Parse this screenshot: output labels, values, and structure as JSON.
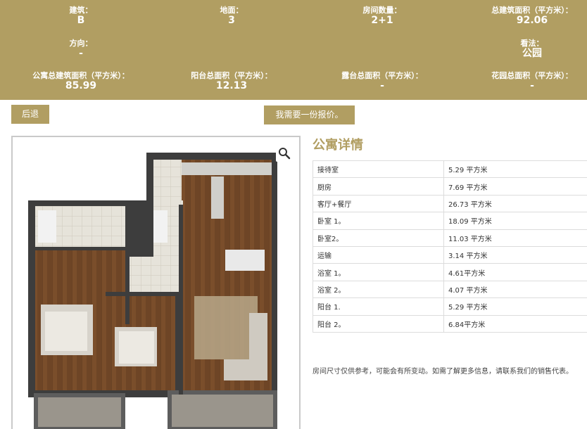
{
  "header": {
    "stats": [
      {
        "label": "建筑：",
        "value": "B"
      },
      {
        "label": "地面：",
        "value": "3"
      },
      {
        "label": "房间数量：",
        "value": "2+1"
      },
      {
        "label": "总建筑面积（平方米）：",
        "value": "92.06"
      },
      {
        "label": "方向：",
        "value": "-"
      },
      {
        "label": "看法：",
        "value": "公园"
      },
      {
        "label": "公寓总建筑面积（平方米）：",
        "value": "85.99"
      },
      {
        "label": "阳台总面积（平方米）：",
        "value": "12.13"
      },
      {
        "label": "露台总面积（平方米）：",
        "value": "-"
      },
      {
        "label": "花园总面积（平方米）：",
        "value": "-"
      }
    ]
  },
  "buttons": {
    "back": "后退",
    "quote": "我需要一份报价。"
  },
  "details": {
    "title": "公寓详情",
    "rooms": [
      {
        "name": "接待室",
        "area": "5.29 平方米"
      },
      {
        "name": "厨房",
        "area": "7.69 平方米"
      },
      {
        "name": "客厅+餐厅",
        "area": "26.73 平方米"
      },
      {
        "name": "卧室 1。",
        "area": "18.09 平方米"
      },
      {
        "name": "卧室2。",
        "area": "11.03 平方米"
      },
      {
        "name": "运输",
        "area": "3.14 平方米"
      },
      {
        "name": "浴室 1。",
        "area": "4.61平方米"
      },
      {
        "name": "浴室 2。",
        "area": "4.07 平方米"
      },
      {
        "name": "阳台 1.",
        "area": "5.29 平方米"
      },
      {
        "name": "阳台 2。",
        "area": "6.84平方米"
      }
    ],
    "note": "房间尺寸仅供参考，可能会有所变动。如需了解更多信息，请联系我们的销售代表。"
  },
  "colors": {
    "accent": "#b19e62",
    "wall": "#3d3d3d",
    "wood": "#6b4325",
    "tile": "#e4e1d9"
  },
  "icons": {
    "zoom": "magnifier-icon"
  }
}
